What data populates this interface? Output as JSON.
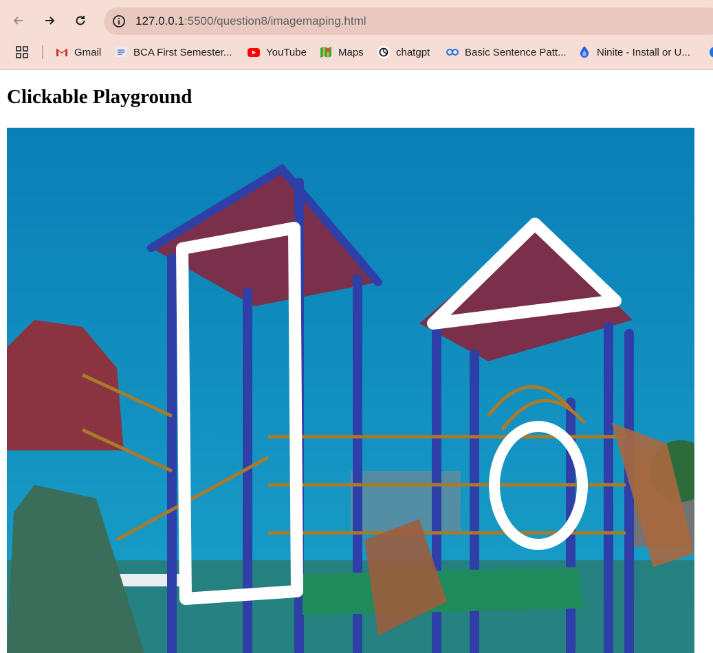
{
  "browser": {
    "address": {
      "host": "127.0.0.1",
      "path": ":5500/question8/imagemaping.html"
    },
    "bookmarks": [
      {
        "label": "",
        "icon": "apps-grid-icon"
      },
      {
        "label": "Gmail",
        "icon": "gmail-icon"
      },
      {
        "label": "BCA First Semester...",
        "icon": "bca-site-icon"
      },
      {
        "label": "YouTube",
        "icon": "youtube-icon"
      },
      {
        "label": "Maps",
        "icon": "maps-icon"
      },
      {
        "label": "chatgpt",
        "icon": "chatgpt-icon"
      },
      {
        "label": "Basic Sentence Patt...",
        "icon": "sentence-site-icon"
      },
      {
        "label": "Ninite - Install or U...",
        "icon": "ninite-icon"
      }
    ]
  },
  "page": {
    "title": "Clickable Playground",
    "map_areas": [
      {
        "shape": "rect",
        "name": "slide-tower"
      },
      {
        "shape": "poly",
        "name": "triangle-roof"
      },
      {
        "shape": "circle",
        "name": "tunnel-ring"
      }
    ]
  },
  "colors": {
    "sky": "#0c8bbd",
    "frame": "#2f3fa8",
    "roof": "#7a2f4a",
    "deck": "#1f8a5c",
    "rails": "#a87a2a"
  }
}
